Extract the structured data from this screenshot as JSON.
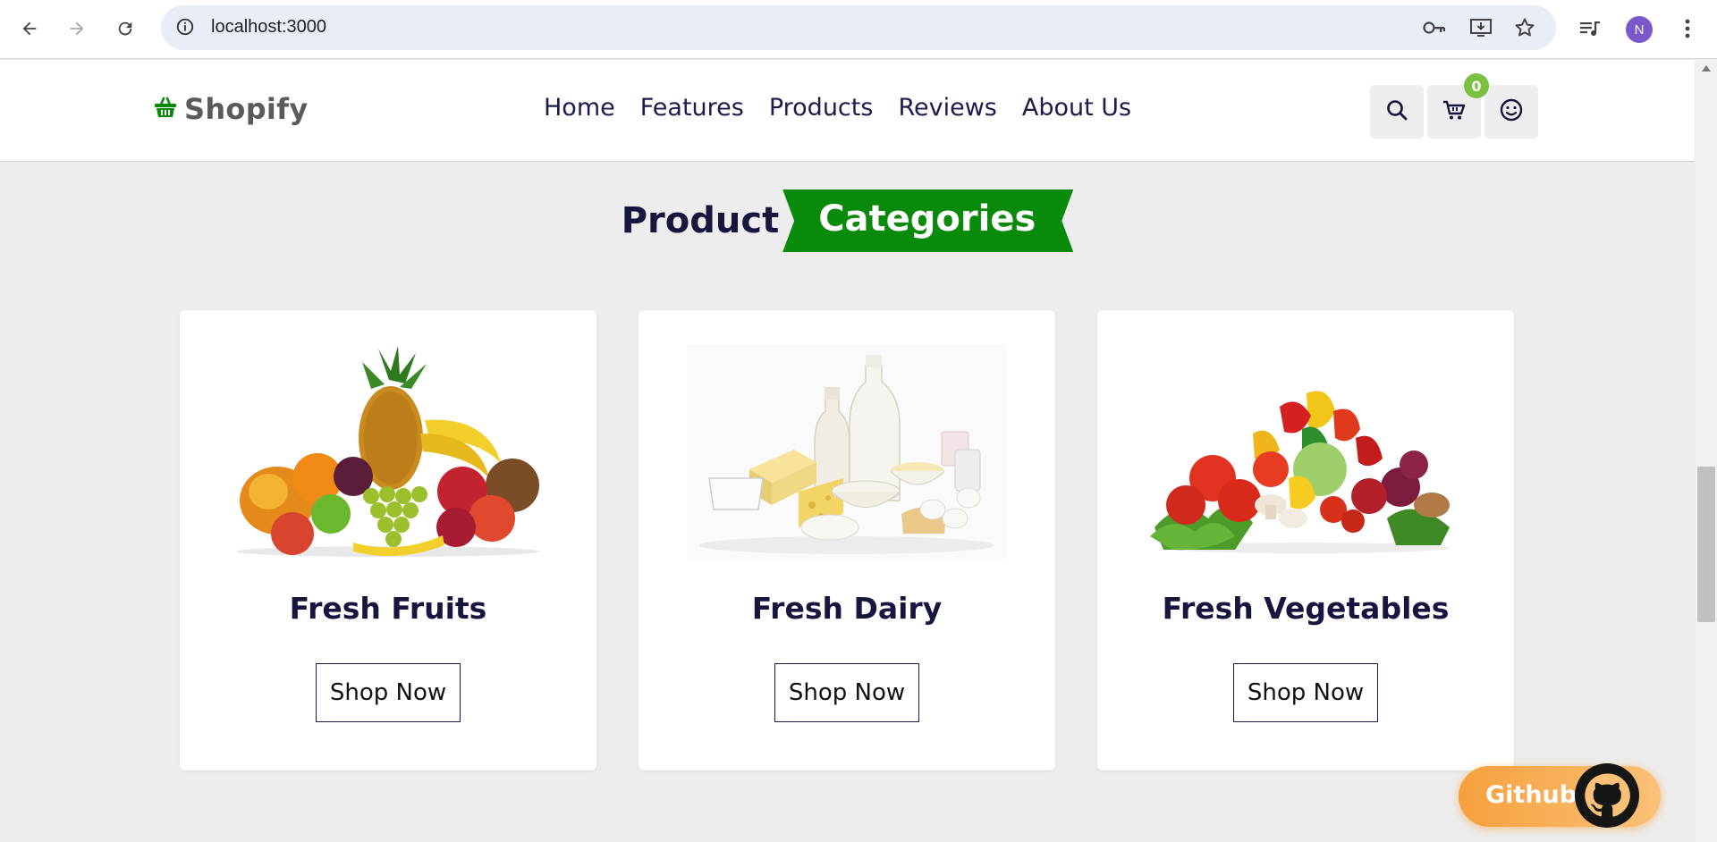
{
  "browser": {
    "url": "localhost:3000",
    "profile_initial": "N",
    "icons": [
      "back-arrow-icon",
      "forward-arrow-icon",
      "reload-icon",
      "site-info-icon",
      "key-icon",
      "install-app-icon",
      "bookmark-star-icon",
      "media-controls-icon",
      "kebab-menu-icon"
    ]
  },
  "header": {
    "logo_text": "Shopify",
    "nav": [
      {
        "label": "Home"
      },
      {
        "label": "Features"
      },
      {
        "label": "Products"
      },
      {
        "label": "Reviews"
      },
      {
        "label": "About Us"
      }
    ],
    "cart_count": "0",
    "icons": [
      "search-icon",
      "cart-icon",
      "user-smile-icon"
    ]
  },
  "section": {
    "heading_plain": "Product",
    "heading_highlight": "Categories"
  },
  "categories": [
    {
      "title": "Fresh Fruits",
      "button": "Shop Now",
      "image": "fruits-image"
    },
    {
      "title": "Fresh Dairy",
      "button": "Shop Now",
      "image": "dairy-image"
    },
    {
      "title": "Fresh Vegetables",
      "button": "Shop Now",
      "image": "vegetables-image"
    }
  ],
  "github": {
    "label": "Github"
  },
  "colors": {
    "brand_green": "#0a8a0a",
    "heading_navy": "#16163f",
    "badge_green": "#7ac142",
    "github_orange": "#f6a03c",
    "page_bg": "#ededed"
  }
}
